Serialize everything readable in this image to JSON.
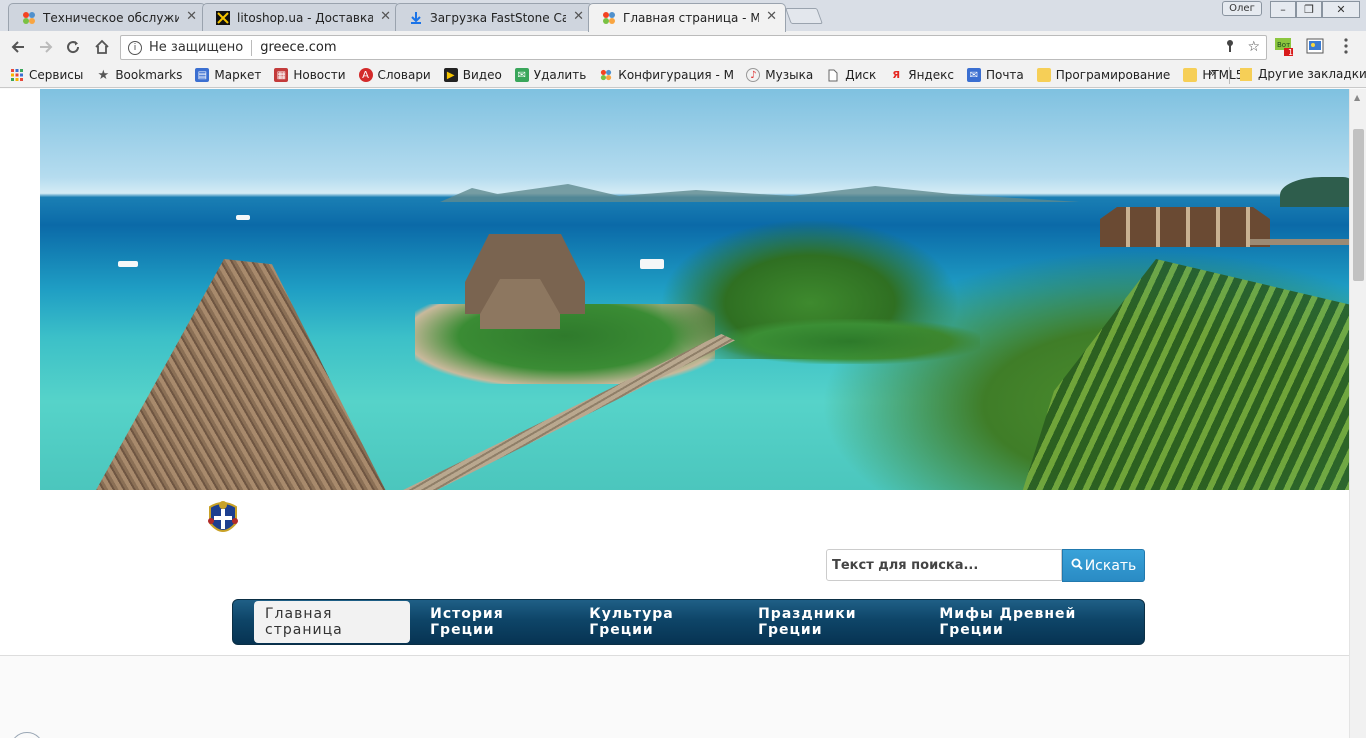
{
  "browser": {
    "tabs": [
      {
        "title": "Техническое обслужива",
        "favicon": "joomla-icon",
        "active": false
      },
      {
        "title": "litoshop.ua - Доставка и",
        "favicon": "litoshop-icon",
        "active": false
      },
      {
        "title": "Загрузка FastStone Capt",
        "favicon": "download-icon",
        "active": false
      },
      {
        "title": "Главная страница - Муз",
        "favicon": "joomla-icon",
        "active": true
      }
    ],
    "close_glyph": "✕",
    "user_name": "Олег",
    "window_controls": [
      "–",
      "❐",
      "✕"
    ],
    "address": {
      "security_text": "Не защищено",
      "url": "greece.com"
    },
    "extension_badge": "1",
    "bookmarks": [
      {
        "label": "Сервисы",
        "icon": "apps-icon",
        "color": "#e8483b"
      },
      {
        "label": "Bookmarks",
        "icon": "star-icon",
        "color": "#555555"
      },
      {
        "label": "Маркет",
        "icon": "market-icon",
        "color": "#3b6fd1"
      },
      {
        "label": "Новости",
        "icon": "news-icon",
        "color": "#c33b3b"
      },
      {
        "label": "Словари",
        "icon": "dictionary-icon",
        "color": "#d32a2a"
      },
      {
        "label": "Видео",
        "icon": "video-icon",
        "color": "#222222"
      },
      {
        "label": "Удалить",
        "icon": "mail-delete-icon",
        "color": "#3aa65b"
      },
      {
        "label": "Конфигурация - Муз",
        "icon": "joomla-icon",
        "color": "#e8862b"
      },
      {
        "label": "Музыка",
        "icon": "music-icon",
        "color": "#d33"
      },
      {
        "label": "Диск",
        "icon": "file-icon",
        "color": "#666666"
      },
      {
        "label": "Яндекс",
        "icon": "yandex-icon",
        "color": "#e52620"
      },
      {
        "label": "Почта",
        "icon": "mail-icon",
        "color": "#3b6fd1"
      },
      {
        "label": "Програмирование",
        "icon": "folder-icon",
        "color": "#f6cf57"
      },
      {
        "label": "HTML5",
        "icon": "folder-icon",
        "color": "#f6cf57"
      }
    ],
    "more_glyph": "»",
    "other_bookmarks": "Другие закладки"
  },
  "page": {
    "search": {
      "placeholder": "Текст для поиска...",
      "button_label": "Искать"
    },
    "menu": [
      {
        "label": "Главная страница",
        "active": true
      },
      {
        "label": "История Греции",
        "active": false
      },
      {
        "label": "Культура Греции",
        "active": false
      },
      {
        "label": "Праздники Греции",
        "active": false
      },
      {
        "label": "Мифы Древней Греции",
        "active": false
      }
    ]
  }
}
